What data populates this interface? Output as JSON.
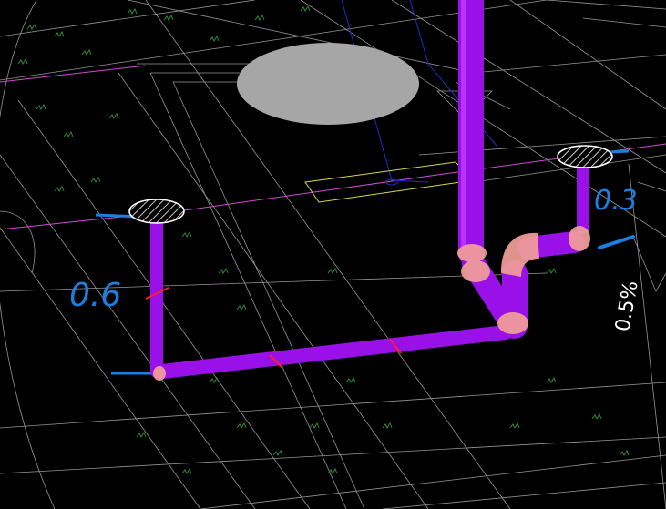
{
  "annotations": {
    "left_size": "0.6",
    "right_size": "0.3",
    "slope": "0.5%"
  },
  "colors": {
    "background": "#000000",
    "pipe": "#9a10e8",
    "pipe_highlight": "#b535ff",
    "fitting": "#f2a09a",
    "annotation_blue": "#1a7fe0",
    "cad_line": "#c8c8c8",
    "grass": "#2e8a3a",
    "magenta_line": "#d04ad0",
    "yellow_line": "#d8d84a",
    "blue_line": "#1a30c8",
    "grey_disc": "#a6a6a6"
  },
  "icons": [
    "floor-drain-hatch-icon",
    "grass-hatch-icon"
  ]
}
